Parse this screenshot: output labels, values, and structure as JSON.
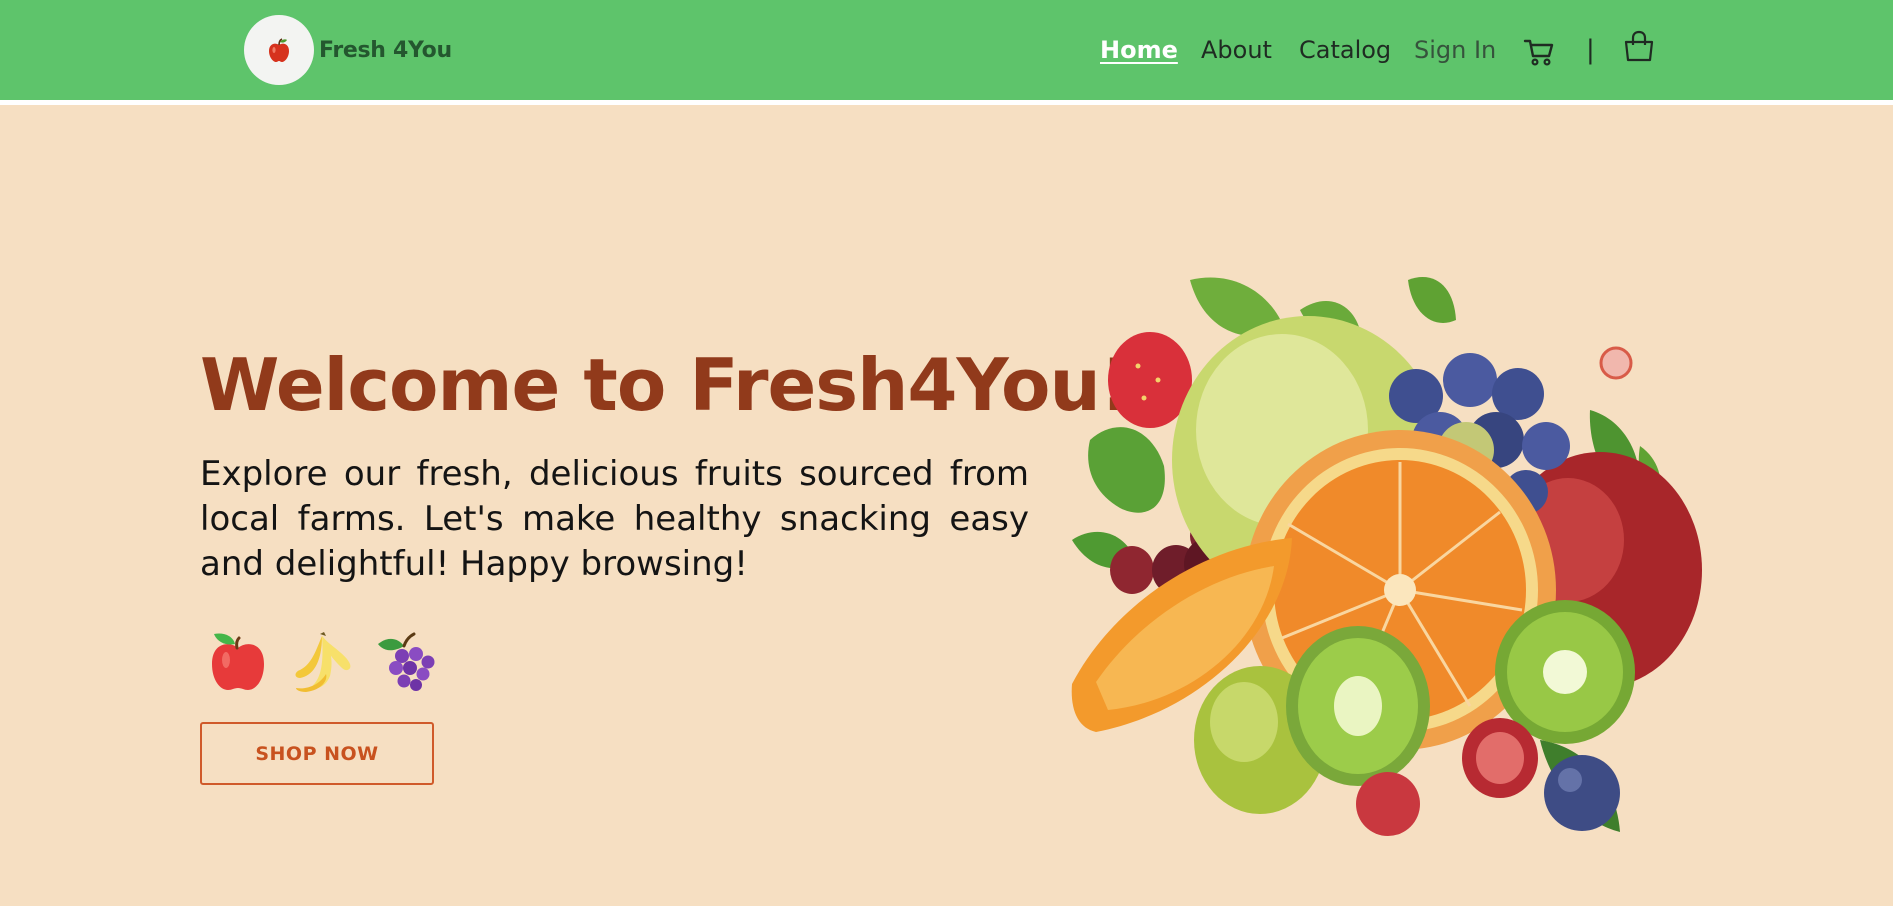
{
  "brand": {
    "name": "Fresh 4You",
    "logo_icon": "apple-icon"
  },
  "nav": {
    "items": [
      {
        "label": "Home",
        "active": true
      },
      {
        "label": "About",
        "active": false
      },
      {
        "label": "Catalog",
        "active": false
      },
      {
        "label": "Sign In",
        "active": false
      }
    ],
    "separator": "|",
    "icons": [
      "cart-icon",
      "shopping-bag-icon"
    ]
  },
  "hero": {
    "title": "Welcome to Fresh4You!",
    "description": "Explore our fresh, delicious fruits sourced from local farms. Let's make healthy snacking easy and delightful! Happy browsing!",
    "fruit_icons": [
      "apple-icon",
      "banana-icon",
      "grapes-icon"
    ],
    "cta_label": "SHOP NOW",
    "image": "fruit-arrangement-image"
  },
  "colors": {
    "nav_background": "#5ec46b",
    "page_background": "#f6dfc2",
    "title": "#913a1b",
    "cta": "#d05a2a"
  }
}
